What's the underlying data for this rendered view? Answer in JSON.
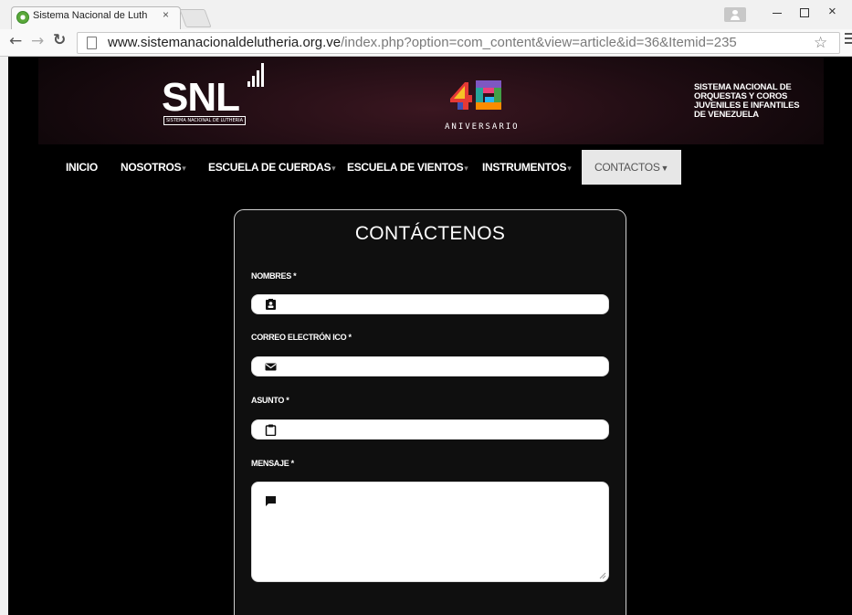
{
  "browser": {
    "tab_title": "Sistema Nacional de Luth",
    "tab_close": "×",
    "url_domain": "www.sistemanacionaldelutheria.org.ve",
    "url_path": "/index.php?option=com_content&view=article&id=36&Itemid=235",
    "window_close": "×"
  },
  "header": {
    "snl_logo_text": "SNL",
    "snl_logo_subtitle": "SISTEMA NACIONAL DE LUTHERIA",
    "anniversary_text": "ANIVERSARIO",
    "sistema_lines": [
      "SISTEMA NACIONAL DE",
      "ORQUESTAS Y COROS",
      "JUVENILES E INFANTILES",
      "DE VENEZUELA"
    ]
  },
  "nav": {
    "items": [
      {
        "label": "INICIO",
        "caret": false
      },
      {
        "label": "NOSOTROS",
        "caret": true
      },
      {
        "label": "ESCUELA DE CUERDAS",
        "caret": true
      },
      {
        "label": "ESCUELA DE VIENTOS",
        "caret": true
      },
      {
        "label": "INSTRUMENTOS",
        "caret": true
      },
      {
        "label": "CONTACTOS",
        "caret": true,
        "active": true
      }
    ]
  },
  "form": {
    "title": "CONTÁCTENOS",
    "nombres_label": "NOMBRES *",
    "correo_label": "CORREO ELECTRÓN ICO *",
    "asunto_label": "ASUNTO *",
    "mensaje_label": "MENSAJE *",
    "nombres_value": "",
    "correo_value": "",
    "asunto_value": "",
    "mensaje_value": ""
  },
  "icons": {
    "nombres": "contact-card-icon",
    "correo": "envelope-icon",
    "asunto": "clipboard-icon",
    "mensaje": "speech-bubble-icon"
  },
  "colors": {
    "page_background": "#000000",
    "active_nav_background": "#e7e7e7",
    "accent_green": "#5aa83a"
  }
}
